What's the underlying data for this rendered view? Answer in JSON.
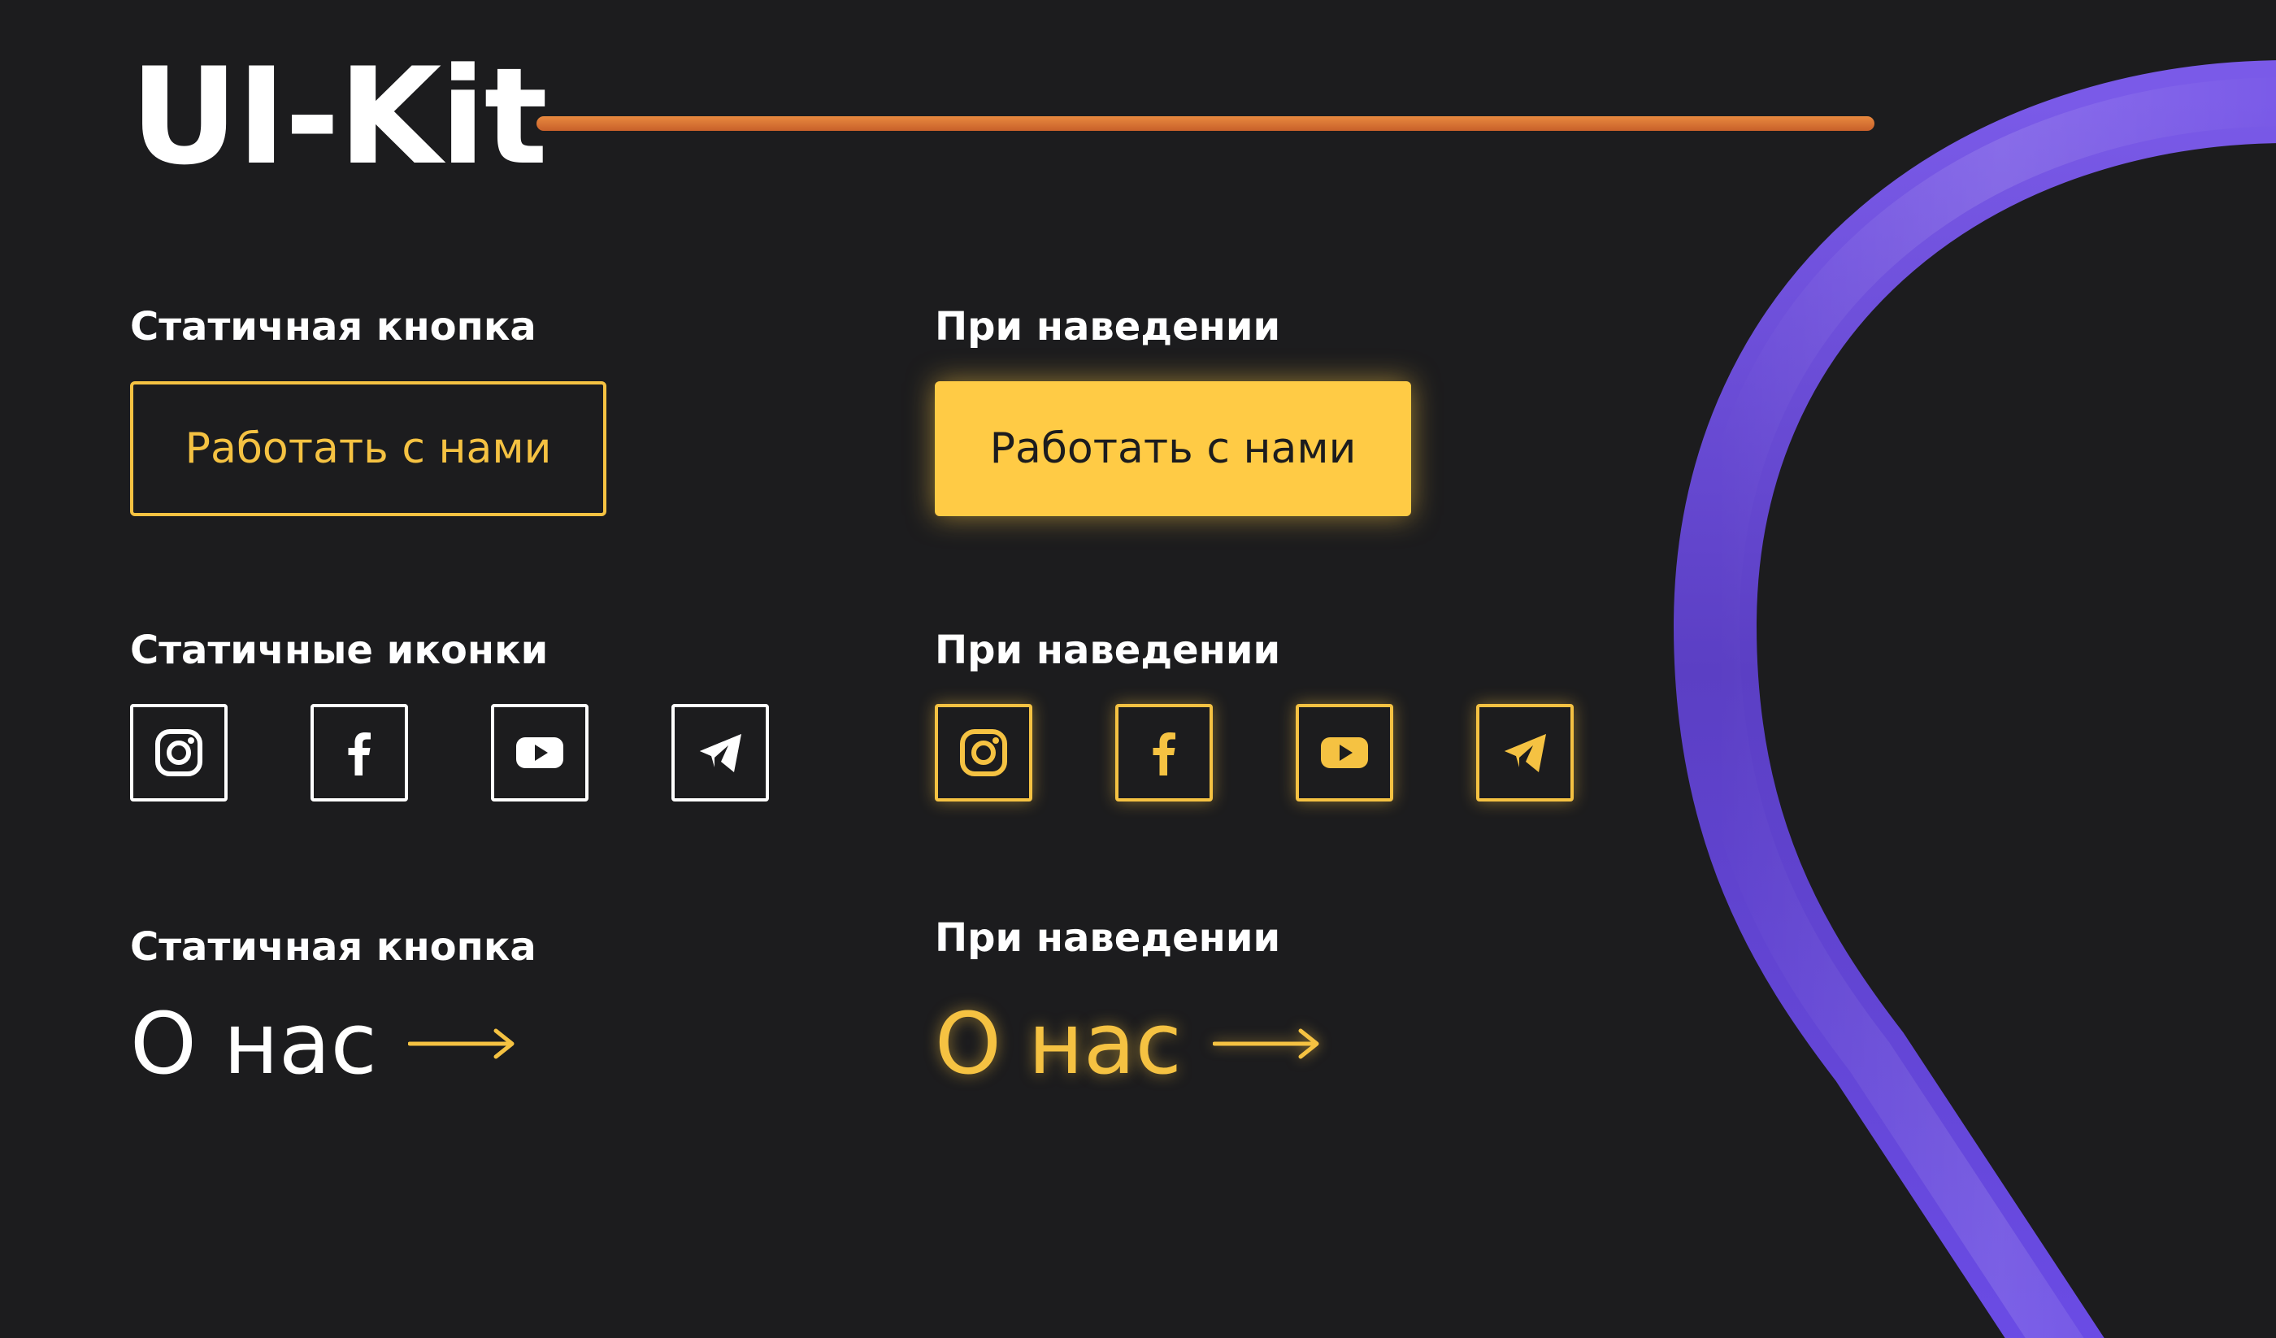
{
  "header": {
    "title": "UI-Kit"
  },
  "sections": {
    "button": {
      "static_label": "Статичная кнопка",
      "hover_label": "При наведении",
      "button_text": "Работать с нами"
    },
    "icons": {
      "static_label": "Статичные иконки",
      "hover_label": "При наведении",
      "items": [
        "instagram-icon",
        "facebook-icon",
        "youtube-icon",
        "telegram-icon"
      ]
    },
    "link": {
      "static_label": "Статичная кнопка",
      "hover_label": "При наведении",
      "link_text": "О нас"
    }
  },
  "colors": {
    "background": "#1c1c1e",
    "accent_yellow": "#ffcb45",
    "accent_orange": "#e8893f",
    "accent_purple": "#6a4de0",
    "text": "#ffffff"
  }
}
